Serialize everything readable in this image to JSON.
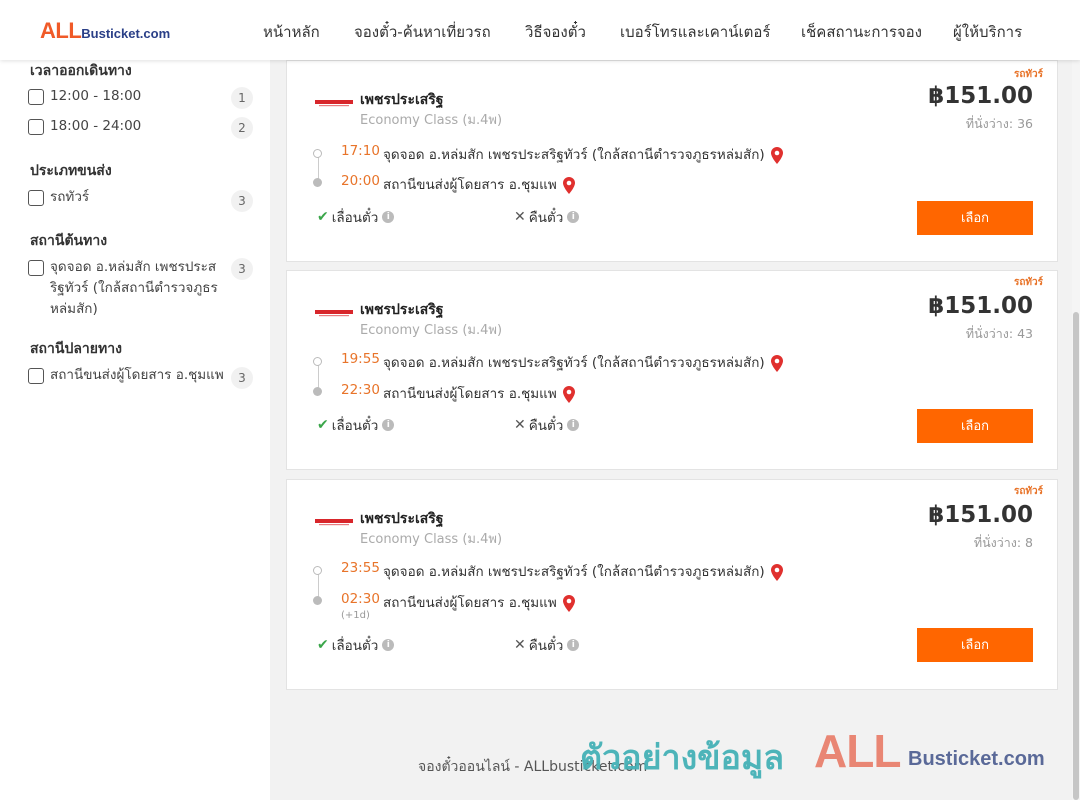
{
  "brand": {
    "all": "ALL",
    "rest": "Busticket.com"
  },
  "nav": [
    "หน้าหลัก",
    "จองตั๋ว-ค้นหาเที่ยวรถ",
    "วิธีจองตั๋ว",
    "เบอร์โทรและเคาน์เตอร์",
    "เช็คสถานะการจอง",
    "ผู้ให้บริการ"
  ],
  "sidebar": {
    "departure_time": {
      "heading": "เวลาออกเดินทาง",
      "options": [
        {
          "label": "12:00 - 18:00",
          "count": "1"
        },
        {
          "label": "18:00 - 24:00",
          "count": "2"
        }
      ]
    },
    "transport_type": {
      "heading": "ประเภทขนส่ง",
      "options": [
        {
          "label": "รถทัวร์",
          "count": "3"
        }
      ]
    },
    "origin": {
      "heading": "สถานีต้นทาง",
      "options": [
        {
          "label": "จุดจอด อ.หล่มสัก เพชรประสริฐทัวร์ (ใกล้สถานีตำรวจภูธรหล่มสัก)",
          "label_lines": [
            "จุดจอด อ.หล่มสัก เพชรประส",
            "ริฐทัวร์ (ใกล้สถานีตำรวจภูธร",
            "หล่มสัก)"
          ],
          "count": "3"
        }
      ]
    },
    "destination": {
      "heading": "สถานีปลายทาง",
      "options": [
        {
          "label": "สถานีขนส่งผู้โดยสาร อ.ชุมแพ",
          "count": "3"
        }
      ]
    }
  },
  "trips": [
    {
      "tag": "รถทัวร์",
      "operator": "เพชรประเสริฐ",
      "class": "Economy Class (ม.4พ)",
      "price": "฿151.00",
      "seats": "ที่นั่งว่าง: 36",
      "depart_time": "17:10",
      "depart_stop": "จุดจอด อ.หล่มสัก เพชรประสริฐทัวร์ (ใกล้สถานีตำรวจภูธรหล่มสัก)",
      "arrive_time": "20:00",
      "arrive_stop": "สถานีขนส่งผู้โดยสาร อ.ชุมแพ",
      "next_day": "",
      "feature_reschedule": "เลื่อนตั๋ว",
      "feature_refund": "คืนตั๋ว",
      "button": "เลือก"
    },
    {
      "tag": "รถทัวร์",
      "operator": "เพชรประเสริฐ",
      "class": "Economy Class (ม.4พ)",
      "price": "฿151.00",
      "seats": "ที่นั่งว่าง: 43",
      "depart_time": "19:55",
      "depart_stop": "จุดจอด อ.หล่มสัก เพชรประสริฐทัวร์ (ใกล้สถานีตำรวจภูธรหล่มสัก)",
      "arrive_time": "22:30",
      "arrive_stop": "สถานีขนส่งผู้โดยสาร อ.ชุมแพ",
      "next_day": "",
      "feature_reschedule": "เลื่อนตั๋ว",
      "feature_refund": "คืนตั๋ว",
      "button": "เลือก"
    },
    {
      "tag": "รถทัวร์",
      "operator": "เพชรประเสริฐ",
      "class": "Economy Class (ม.4พ)",
      "price": "฿151.00",
      "seats": "ที่นั่งว่าง: 8",
      "depart_time": "23:55",
      "depart_stop": "จุดจอด อ.หล่มสัก เพชรประสริฐทัวร์ (ใกล้สถานีตำรวจภูธรหล่มสัก)",
      "arrive_time": "02:30",
      "arrive_stop": "สถานีขนส่งผู้โดยสาร อ.ชุมแพ",
      "next_day": "(+1d)",
      "feature_reschedule": "เลื่อนตั๋ว",
      "feature_refund": "คืนตั๋ว",
      "button": "เลือก"
    }
  ],
  "footer": "จองตั๋วออนไลน์ - ALLbusticket.com",
  "watermark": {
    "thai": "ตัวอย่างข้อมูล",
    "all": "ALL",
    "rest": "Busticket.com"
  },
  "colors": {
    "accent": "#ff6600",
    "time": "#e8742a",
    "brand_blue": "#2a3f87",
    "pin": "#e0302e"
  }
}
